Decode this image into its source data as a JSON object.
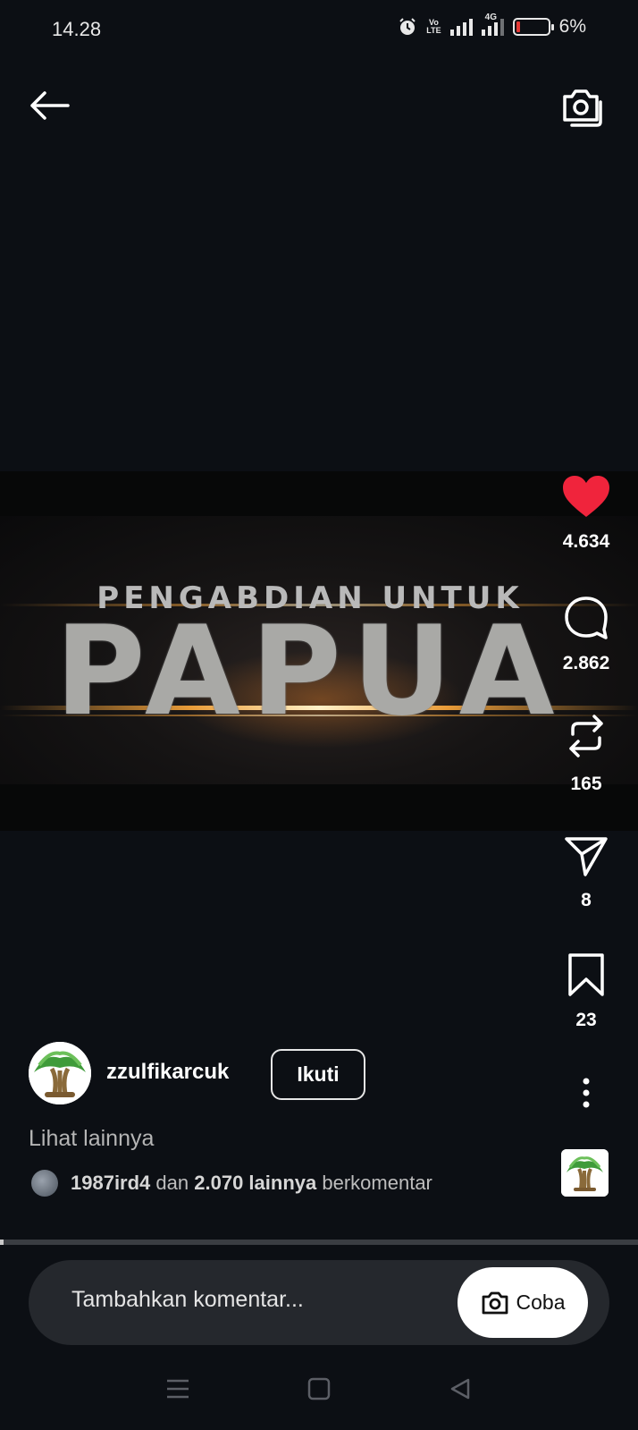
{
  "status_bar": {
    "time": "14.28",
    "volte_top": "Vo",
    "volte_bottom": "LTE",
    "network": "4G",
    "battery": "6%"
  },
  "top_bar": {
    "back_icon": "arrow-left-icon",
    "camera_icon": "camera-switch-icon"
  },
  "video": {
    "subtitle": "PENGABDIAN UNTUK",
    "title": "PAPUA"
  },
  "actions": {
    "likes": "4.634",
    "comments": "2.862",
    "reposts": "165",
    "shares": "8",
    "saves": "23",
    "like_color": "#f0243c"
  },
  "author": {
    "username": "zzulfikarcuk",
    "follow_label": "Ikuti"
  },
  "caption": {
    "see_more": "Lihat lainnya"
  },
  "commenters": {
    "user": "1987ird4",
    "conj": "dan",
    "others": "2.070 lainnya",
    "suffix": "berkomentar"
  },
  "progress": {
    "fraction": 0.005
  },
  "comment_bar": {
    "placeholder": "Tambahkan komentar...",
    "try_label": "Coba"
  },
  "nav_bar": {
    "icons": [
      "menu-icon",
      "home-square-icon",
      "back-triangle-icon"
    ]
  }
}
